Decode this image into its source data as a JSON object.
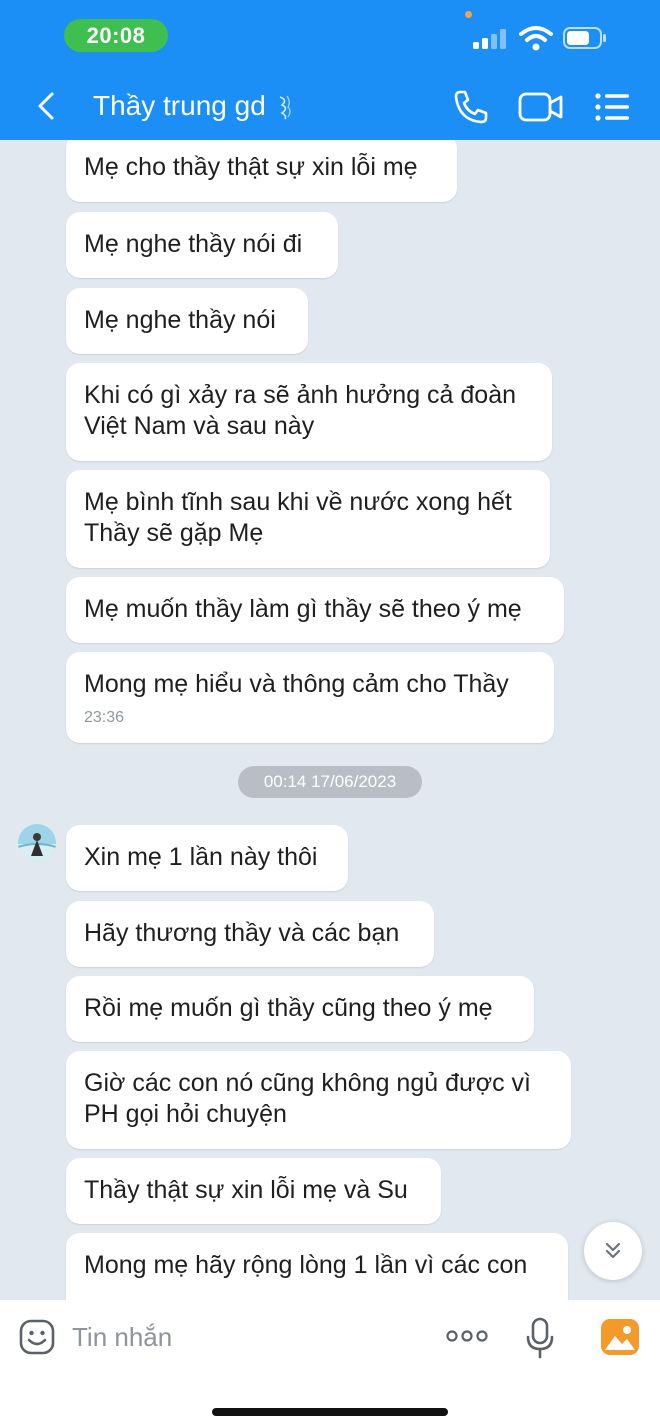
{
  "status_bar": {
    "time": "20:08"
  },
  "header": {
    "contact_name": "Thầy trung gd"
  },
  "messages_before": [
    {
      "text": "Mẹ cho thầy thật sự xin lỗi mẹ"
    },
    {
      "text": "Mẹ nghe thầy nói đi"
    },
    {
      "text": "Mẹ nghe thầy nói"
    },
    {
      "text": "Khi có gì xảy ra sẽ ảnh hưởng cả đoàn\nViệt Nam và sau này"
    },
    {
      "text": "Mẹ bình tĩnh sau khi về nước xong hết\nThầy sẽ gặp Mẹ"
    },
    {
      "text": "Mẹ muốn thầy làm gì thầy sẽ theo ý mẹ"
    },
    {
      "text": "Mong mẹ hiểu và thông cảm cho Thầy",
      "time": "23:36"
    }
  ],
  "date_separator": "00:14 17/06/2023",
  "messages_after": [
    {
      "text": "Xin mẹ 1 lần này thôi"
    },
    {
      "text": "Hãy thương thầy và các bạn"
    },
    {
      "text": "Rồi mẹ muốn gì thầy cũng theo ý mẹ"
    },
    {
      "text": "Giờ các con nó cũng không ngủ được vì\nPH gọi hỏi chuyện"
    },
    {
      "text": "Thầy thật sự xin lỗi mẹ và Su"
    },
    {
      "text": "Mong mẹ hãy rộng lòng 1 lần vì các con"
    }
  ],
  "input_bar": {
    "placeholder": "Tin nhắn"
  },
  "icons": {
    "back": "chevron-left-icon",
    "call": "phone-icon",
    "video": "video-camera-icon",
    "menu": "list-menu-icon",
    "emoji": "emoji-icon",
    "more": "more-dots-icon",
    "mic": "microphone-icon",
    "image": "image-icon",
    "scroll": "double-chevron-down-icon"
  },
  "colors": {
    "header_blue": "#1b8ff6",
    "time_pill_green": "#3fbf4f",
    "chat_background": "#e2e8f0",
    "bubble": "#ffffff",
    "image_icon_orange": "#f39a2a"
  }
}
